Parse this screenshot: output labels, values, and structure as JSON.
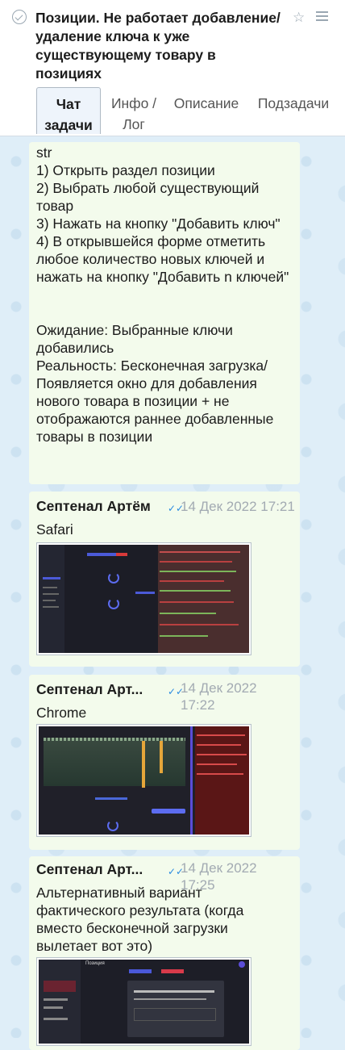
{
  "header": {
    "title": "Позиции. Не работает добавление/удаление ключа к уже существующему товару в позициях",
    "tabs": [
      {
        "line1": "Чат",
        "line2": "задачи"
      },
      {
        "line1": "Инфо /",
        "line2": "Лог"
      },
      {
        "line1": "Описание",
        "line2": ""
      },
      {
        "line1": "Подзадачи",
        "line2": ""
      }
    ]
  },
  "messages": [
    {
      "text": "str\n1) Открыть раздел позиции\n2) Выбрать любой существующий товар\n3) Нажать на кнопку \"Добавить ключ\"\n4) В открывшейся форме отметить любое количество новых ключей и нажать на кнопку \"Добавить n ключей\"\n\n\nОжидание: Выбранные ключи добавились\nРеальность: Бесконечная загрузка/ Появляется окно для добавления нового товара в позиции + не отображаются раннее добавленные товары в позиции"
    },
    {
      "author": "Септенал Артём",
      "time": "14 Дек 2022 17:21",
      "text": "Safari"
    },
    {
      "author": "Септенал Арт...",
      "time_line1": "14 Дек 2022",
      "time_line2": "17:22",
      "text": "Chrome"
    },
    {
      "author": "Септенал Арт...",
      "time_line1": "14 Дек 2022",
      "time_line2": "17:25",
      "text": "Альтернативный вариант фактического результата (когда вместо бесконечной загрузки вылетает вот это)",
      "shot_title": "Позиция"
    }
  ]
}
